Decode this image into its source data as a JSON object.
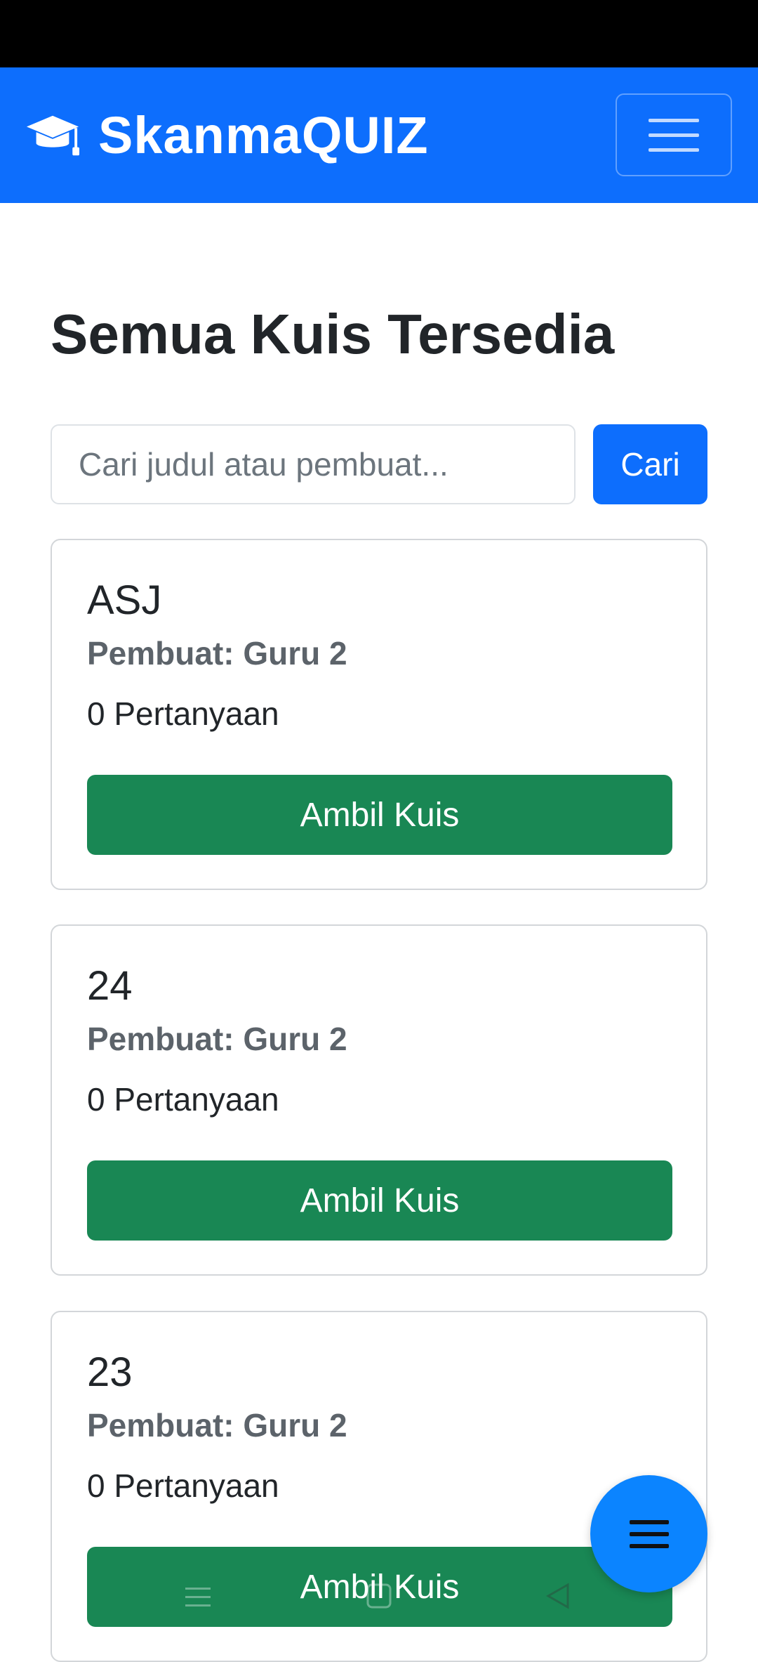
{
  "app": {
    "brand": "SkanmaQUIZ",
    "brand_icon": "graduation-cap-icon",
    "menu_icon": "hamburger-icon"
  },
  "page": {
    "title": "Semua Kuis Tersedia"
  },
  "search": {
    "placeholder": "Cari judul atau pembuat...",
    "value": "",
    "button_label": "Cari"
  },
  "quizzes": [
    {
      "title": "ASJ",
      "creator": "Pembuat: Guru 2",
      "questions": "0 Pertanyaan",
      "button": "Ambil Kuis"
    },
    {
      "title": "24",
      "creator": "Pembuat: Guru 2",
      "questions": "0 Pertanyaan",
      "button": "Ambil Kuis"
    },
    {
      "title": "23",
      "creator": "Pembuat: Guru 2",
      "questions": "0 Pertanyaan",
      "button": "Ambil Kuis"
    }
  ],
  "colors": {
    "primary": "#0d6efd",
    "success": "#198754",
    "fab": "#0b84ff",
    "muted": "#5c636a"
  }
}
